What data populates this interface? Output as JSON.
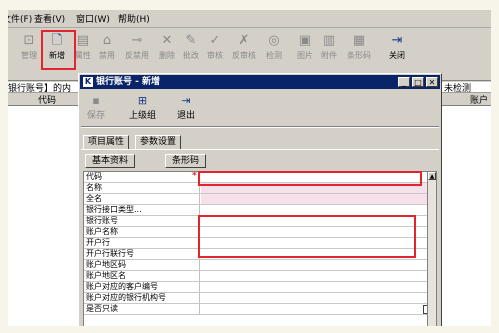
{
  "menu": [
    "文件(F)",
    "查看(V)",
    "窗口(W)",
    "帮助(H)"
  ],
  "toolbar": [
    {
      "icon": "manage-icon",
      "label": "管理",
      "enabled": false
    },
    {
      "icon": "new-icon",
      "label": "新增",
      "enabled": true
    },
    {
      "icon": "attribute-icon",
      "label": "属性",
      "enabled": false
    },
    {
      "icon": "disable-icon",
      "label": "禁用",
      "enabled": false
    },
    {
      "icon": "enable-icon",
      "label": "反禁用",
      "enabled": false
    },
    {
      "icon": "delete-icon",
      "label": "删除",
      "enabled": false
    },
    {
      "icon": "batch-edit-icon",
      "label": "批改",
      "enabled": false
    },
    {
      "icon": "audit-icon",
      "label": "审核",
      "enabled": false
    },
    {
      "icon": "unaudit-icon",
      "label": "反审核",
      "enabled": false
    },
    {
      "icon": "inspect-icon",
      "label": "检测",
      "enabled": false
    },
    {
      "icon": "image-icon",
      "label": "图片",
      "enabled": false
    },
    {
      "icon": "attachment-icon",
      "label": "附件",
      "enabled": false
    },
    {
      "icon": "barcode-icon",
      "label": "条形码",
      "enabled": false
    },
    {
      "icon": "close-icon",
      "label": "关闭",
      "enabled": true
    }
  ],
  "background": {
    "row_text": "银行账号】的内",
    "row_right": "未检测",
    "col_code": "代码",
    "col_account": "账户"
  },
  "dialog": {
    "title": "银行账号 - 新增",
    "toolbar": [
      {
        "icon": "save-icon",
        "label": "保存",
        "enabled": false
      },
      {
        "icon": "parent-group-icon",
        "label": "上级组",
        "enabled": true
      },
      {
        "icon": "exit-icon",
        "label": "退出",
        "enabled": true
      }
    ],
    "tabs": [
      "项目属性",
      "参数设置"
    ],
    "subtabs": [
      "基本资料",
      "条形码"
    ],
    "fields": [
      {
        "label": "代码",
        "required": true
      },
      {
        "label": "名称",
        "required": false
      },
      {
        "label": "全名",
        "required": false
      },
      {
        "label": "银行接口类型...",
        "required": false
      },
      {
        "label": "银行账号",
        "required": false
      },
      {
        "label": "账户名称",
        "required": false
      },
      {
        "label": "开户行",
        "required": false
      },
      {
        "label": "开户行联行号",
        "required": false
      },
      {
        "label": "账户地区码",
        "required": false
      },
      {
        "label": "账户地区名",
        "required": false
      },
      {
        "label": "账户对应的客户编号",
        "required": false
      },
      {
        "label": "账户对应的银行机构号",
        "required": false
      },
      {
        "label": "是否只读",
        "required": false
      }
    ],
    "required_mark": "*"
  },
  "colors": {
    "highlight_red": "#e0252e",
    "title_bar": "#0a246a",
    "required_field": "#f6e1ea"
  }
}
